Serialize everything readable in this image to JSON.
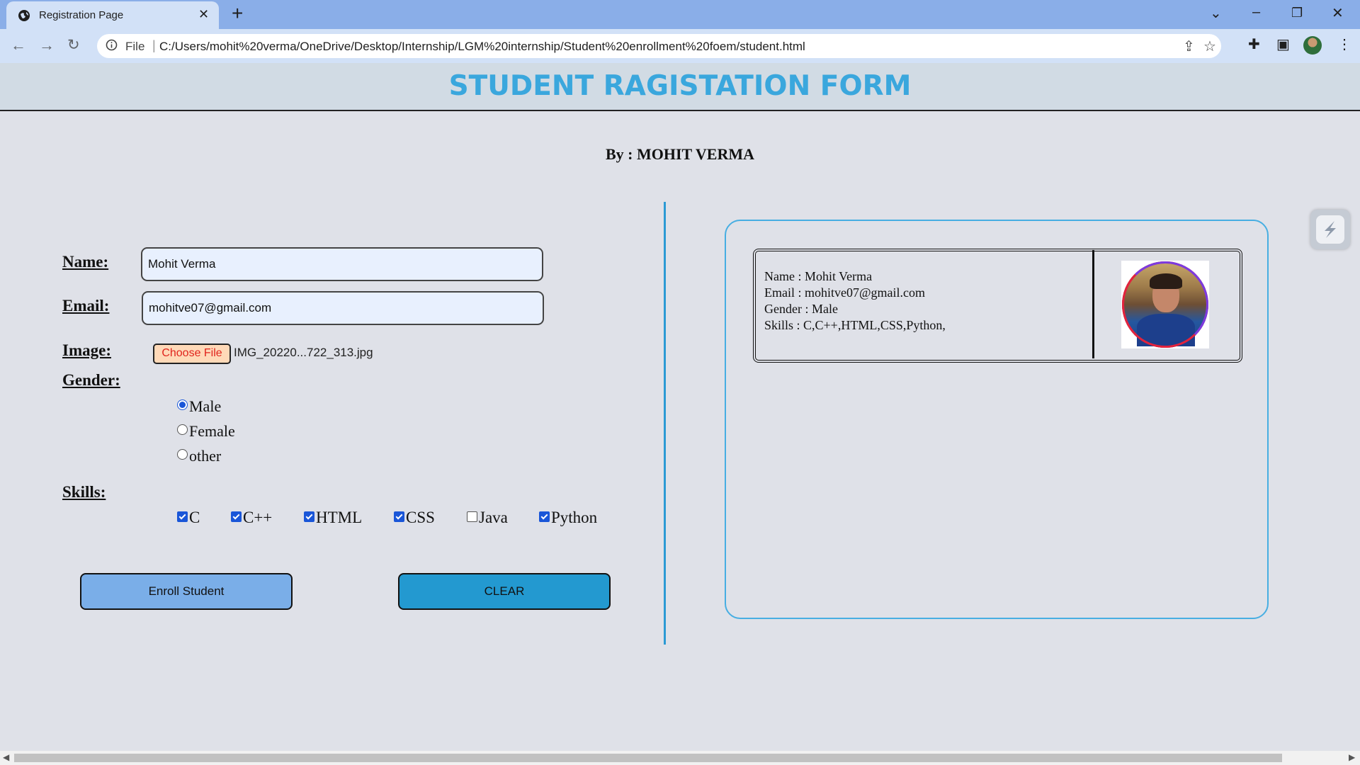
{
  "browser": {
    "tab_title": "Registration Page",
    "new_tab": "+",
    "address_scheme": "File",
    "address_url": "C:/Users/mohit%20verma/OneDrive/Desktop/Internship/LGM%20internship/Student%20enrollment%20foem/student.html"
  },
  "page": {
    "title": "STUDENT RAGISTATION FORM",
    "byline": "By : MOHIT VERMA"
  },
  "form": {
    "name_label": "Name:",
    "name_value": "Mohit Verma",
    "email_label": "Email:",
    "email_value": "mohitve07@gmail.com",
    "image_label": "Image:",
    "choose_file_label": "Choose File",
    "file_name": "IMG_20220...722_313.jpg",
    "gender_label": "Gender:",
    "gender_options": [
      {
        "label": "Male",
        "checked": true
      },
      {
        "label": "Female",
        "checked": false
      },
      {
        "label": "other",
        "checked": false
      }
    ],
    "skills_label": "Skills:",
    "skills": [
      {
        "label": "C",
        "checked": true
      },
      {
        "label": "C++",
        "checked": true
      },
      {
        "label": "HTML",
        "checked": true
      },
      {
        "label": "CSS",
        "checked": true
      },
      {
        "label": "Java",
        "checked": false
      },
      {
        "label": "Python",
        "checked": true
      }
    ],
    "enroll_button": "Enroll Student",
    "clear_button": "CLEAR"
  },
  "card": {
    "name_line": "Name : Mohit Verma",
    "email_line": "Email : mohitve07@gmail.com",
    "gender_line": "Gender : Male",
    "skills_line": "Skills : C,C++,HTML,CSS,Python,"
  },
  "colors": {
    "title": "#3aa7dd",
    "enroll_button": "#7aaee8",
    "clear_button": "#2399d0",
    "accent_border": "#47aee2",
    "page_bg": "#dfe1e8"
  }
}
